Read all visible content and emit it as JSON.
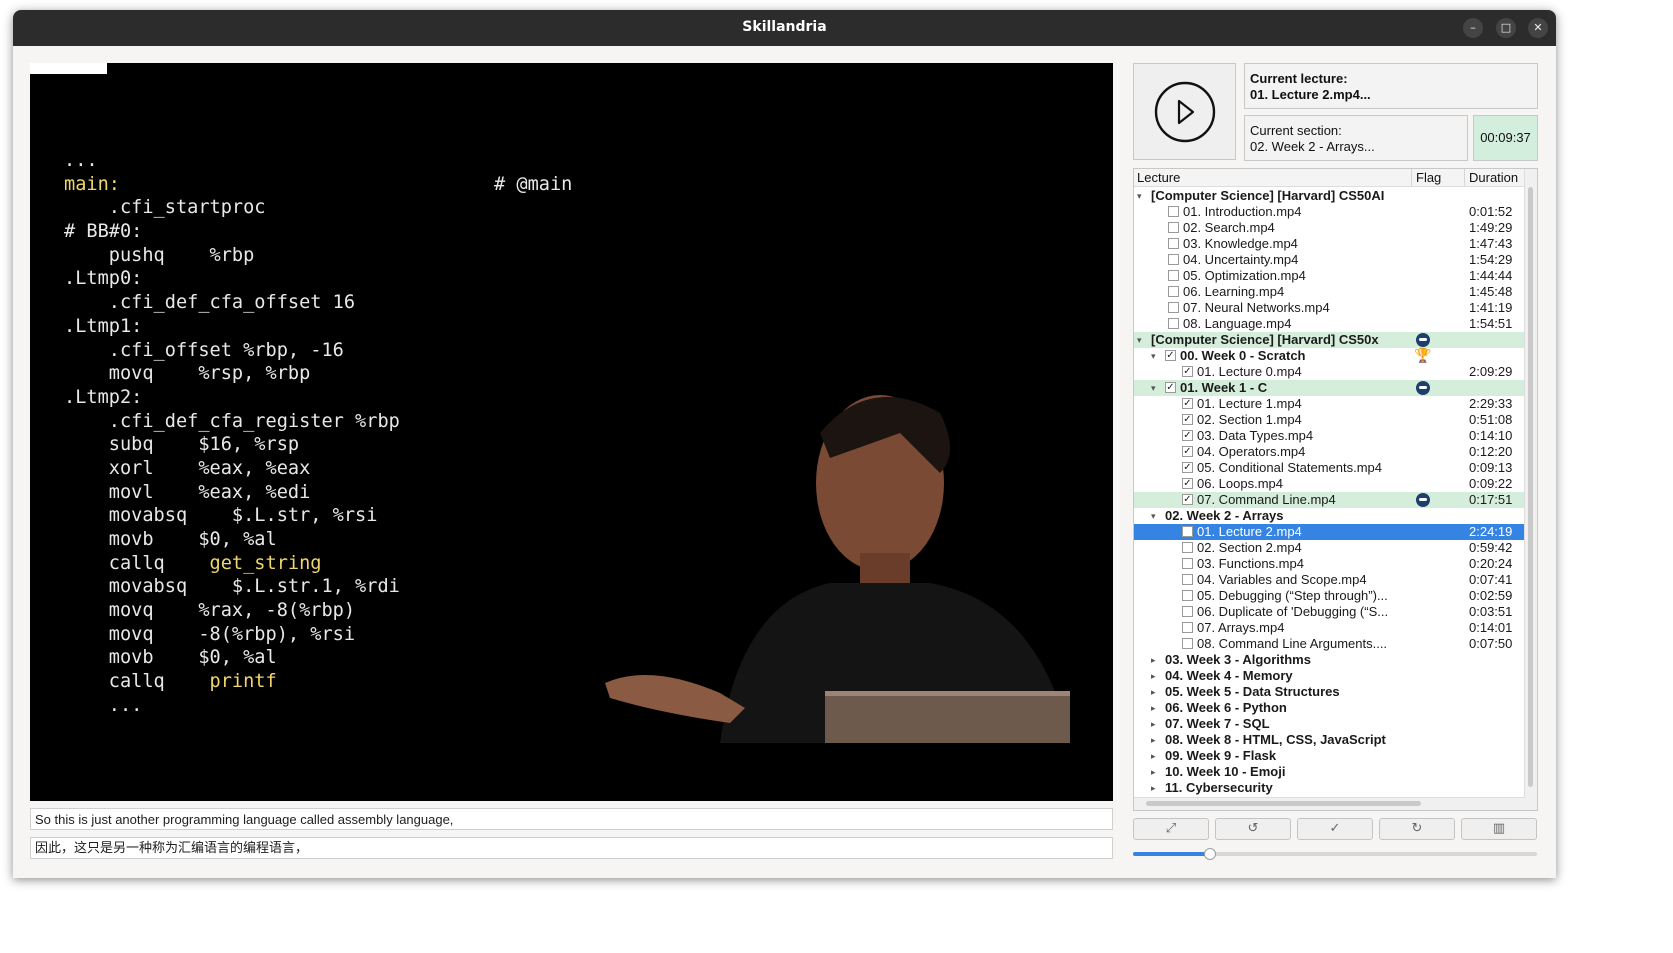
{
  "window": {
    "title": "Skillandria",
    "controls": [
      "–",
      "□",
      "✕"
    ]
  },
  "video": {
    "code_lines": [
      {
        "t": "...",
        "y": false
      },
      {
        "t": "main:",
        "y": true
      },
      {
        "t": "    .cfi_startproc",
        "y": false
      },
      {
        "t": "# BB#0:",
        "y": false
      },
      {
        "t": "    pushq    %rbp",
        "y": false
      },
      {
        "t": ".Ltmp0:",
        "y": false
      },
      {
        "t": "    .cfi_def_cfa_offset 16",
        "y": false
      },
      {
        "t": ".Ltmp1:",
        "y": false
      },
      {
        "t": "    .cfi_offset %rbp, -16",
        "y": false
      },
      {
        "t": "    movq    %rsp, %rbp",
        "y": false
      },
      {
        "t": ".Ltmp2:",
        "y": false
      },
      {
        "t": "    .cfi_def_cfa_register %rbp",
        "y": false
      },
      {
        "t": "    subq    $16, %rsp",
        "y": false
      },
      {
        "t": "    xorl    %eax, %eax",
        "y": false
      },
      {
        "t": "    movl    %eax, %edi",
        "y": false
      },
      {
        "t": "    movabsq    $.L.str, %rsi",
        "y": false
      },
      {
        "t": "    movb    $0, %al",
        "y": false
      },
      {
        "t": "    callq    get_string",
        "y": false,
        "yword": "get_string"
      },
      {
        "t": "    movabsq    $.L.str.1, %rdi",
        "y": false
      },
      {
        "t": "    movq    %rax, -8(%rbp)",
        "y": false
      },
      {
        "t": "    movq    -8(%rbp), %rsi",
        "y": false
      },
      {
        "t": "    movb    $0, %al",
        "y": false
      },
      {
        "t": "    callq    printf",
        "y": false,
        "yword": "printf"
      },
      {
        "t": "    ...",
        "y": false
      }
    ],
    "comment": "# @main"
  },
  "subtitles": {
    "english": "So this is just another programming language called assembly language,",
    "chinese": "因此，这只是另一种称为汇编语言的编程语言，"
  },
  "current": {
    "lecture_label": "Current lecture:",
    "lecture_value": "01. Lecture 2.mp4...",
    "section_label": "Current section:",
    "section_value": "02. Week 2 - Arrays...",
    "time": "00:09:37"
  },
  "tree": {
    "headers": {
      "lecture": "Lecture",
      "flag": "Flag",
      "duration": "Duration"
    },
    "rows": [
      {
        "level": 0,
        "arrow": "open",
        "label": "[Computer Science] [Harvard] CS50AI",
        "bold": true
      },
      {
        "level": 2,
        "cb": "",
        "label": "01. Introduction.mp4",
        "dur": "0:01:52"
      },
      {
        "level": 2,
        "cb": "",
        "label": "02. Search.mp4",
        "dur": "1:49:29"
      },
      {
        "level": 2,
        "cb": "",
        "label": "03. Knowledge.mp4",
        "dur": "1:47:43"
      },
      {
        "level": 2,
        "cb": "",
        "label": "04. Uncertainty.mp4",
        "dur": "1:54:29"
      },
      {
        "level": 2,
        "cb": "",
        "label": "05. Optimization.mp4",
        "dur": "1:44:44"
      },
      {
        "level": 2,
        "cb": "",
        "label": "06. Learning.mp4",
        "dur": "1:45:48"
      },
      {
        "level": 2,
        "cb": "",
        "label": "07. Neural Networks.mp4",
        "dur": "1:41:19"
      },
      {
        "level": 2,
        "cb": "",
        "label": "08. Language.mp4",
        "dur": "1:54:51"
      },
      {
        "level": 0,
        "arrow": "open",
        "label": "[Computer Science] [Harvard] CS50x",
        "bold": true,
        "green": true,
        "flag": "flag"
      },
      {
        "level": 1,
        "arrow": "open",
        "cb": "✓",
        "label": "00. Week 0 - Scratch",
        "bold": true,
        "flag": "trophy"
      },
      {
        "level": 3,
        "cb": "✓",
        "label": "01. Lecture 0.mp4",
        "dur": "2:09:29"
      },
      {
        "level": 1,
        "arrow": "open",
        "cb": "✓",
        "label": "01. Week 1 - C",
        "bold": true,
        "green": true,
        "flag": "flag"
      },
      {
        "level": 3,
        "cb": "✓",
        "label": "01. Lecture 1.mp4",
        "dur": "2:29:33"
      },
      {
        "level": 3,
        "cb": "✓",
        "label": "02. Section 1.mp4",
        "dur": "0:51:08"
      },
      {
        "level": 3,
        "cb": "✓",
        "label": "03. Data Types.mp4",
        "dur": "0:14:10"
      },
      {
        "level": 3,
        "cb": "✓",
        "label": "04. Operators.mp4",
        "dur": "0:12:20"
      },
      {
        "level": 3,
        "cb": "✓",
        "label": "05. Conditional Statements.mp4",
        "dur": "0:09:13"
      },
      {
        "level": 3,
        "cb": "✓",
        "label": "06. Loops.mp4",
        "dur": "0:09:22"
      },
      {
        "level": 3,
        "cb": "✓",
        "label": "07. Command Line.mp4",
        "dur": "0:17:51",
        "green": true,
        "flag": "flag"
      },
      {
        "level": 1,
        "arrow": "open",
        "label": "02. Week 2 - Arrays",
        "bold": true
      },
      {
        "level": 3,
        "cb": "",
        "label": "01. Lecture 2.mp4",
        "dur": "2:24:19",
        "sel": true
      },
      {
        "level": 3,
        "cb": "",
        "label": "02. Section 2.mp4",
        "dur": "0:59:42"
      },
      {
        "level": 3,
        "cb": "",
        "label": "03. Functions.mp4",
        "dur": "0:20:24"
      },
      {
        "level": 3,
        "cb": "",
        "label": "04. Variables and Scope.mp4",
        "dur": "0:07:41"
      },
      {
        "level": 3,
        "cb": "",
        "label": "05. Debugging (“Step through”)...",
        "dur": "0:02:59"
      },
      {
        "level": 3,
        "cb": "",
        "label": "06. Duplicate of 'Debugging (“S...",
        "dur": "0:03:51"
      },
      {
        "level": 3,
        "cb": "",
        "label": "07. Arrays.mp4",
        "dur": "0:14:01"
      },
      {
        "level": 3,
        "cb": "",
        "label": "08. Command Line Arguments....",
        "dur": "0:07:50"
      },
      {
        "level": 1,
        "arrow": "closed",
        "label": "03. Week 3 - Algorithms",
        "bold": true
      },
      {
        "level": 1,
        "arrow": "closed",
        "label": "04. Week 4 - Memory",
        "bold": true
      },
      {
        "level": 1,
        "arrow": "closed",
        "label": "05. Week 5 - Data Structures",
        "bold": true
      },
      {
        "level": 1,
        "arrow": "closed",
        "label": "06. Week 6 - Python",
        "bold": true
      },
      {
        "level": 1,
        "arrow": "closed",
        "label": "07. Week 7 - SQL",
        "bold": true
      },
      {
        "level": 1,
        "arrow": "closed",
        "label": "08. Week 8 - HTML, CSS, JavaScript",
        "bold": true
      },
      {
        "level": 1,
        "arrow": "closed",
        "label": "09. Week 9 - Flask",
        "bold": true
      },
      {
        "level": 1,
        "arrow": "closed",
        "label": "10. Week 10 - Emoji",
        "bold": true
      },
      {
        "level": 1,
        "arrow": "closed",
        "label": "11. Cybersecurity",
        "bold": true
      }
    ]
  },
  "toolbar": [
    {
      "icon": "fullscreen-icon",
      "glyph": "⤢"
    },
    {
      "icon": "rewind-icon",
      "glyph": "↺"
    },
    {
      "icon": "check-icon",
      "glyph": "✓"
    },
    {
      "icon": "forward-icon",
      "glyph": "↻"
    },
    {
      "icon": "columns-icon",
      "glyph": "▥"
    }
  ],
  "volume": 0.19,
  "colors": {
    "accent": "#3584e4",
    "highlight": "#d5eedc",
    "code_yellow": "#f0d66d"
  }
}
